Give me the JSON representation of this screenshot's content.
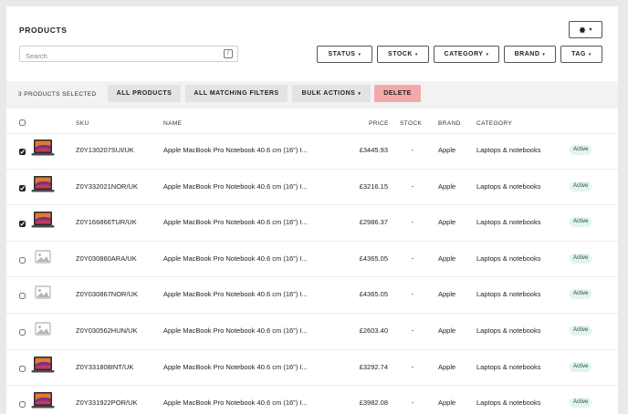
{
  "header": {
    "title": "PRODUCTS",
    "settings_icon": "gear-icon"
  },
  "search": {
    "placeholder": "Search",
    "shortcut": "/"
  },
  "filters": [
    {
      "label": "STATUS"
    },
    {
      "label": "STOCK"
    },
    {
      "label": "CATEGORY"
    },
    {
      "label": "BRAND"
    },
    {
      "label": "TAG"
    }
  ],
  "bulk": {
    "selected_text": "3 PRODUCTS SELECTED",
    "all_products": "ALL PRODUCTS",
    "all_matching": "ALL MATCHING FILTERS",
    "bulk_actions": "BULK ACTIONS",
    "delete": "DELETE"
  },
  "table": {
    "columns": {
      "sku": "SKU",
      "name": "NAME",
      "price": "PRICE",
      "stock": "STOCK",
      "brand": "BRAND",
      "category": "CATEGORY"
    },
    "rows": [
      {
        "selected": true,
        "image": "laptop",
        "sku": "Z0Y130207SUI/UK",
        "name": "Apple MacBook Pro Notebook 40.6 cm (16\") I...",
        "price": "£3445.93",
        "stock": "-",
        "brand": "Apple",
        "category": "Laptops & notebooks",
        "status": "Active"
      },
      {
        "selected": true,
        "image": "laptop",
        "sku": "Z0Y332021NOR/UK",
        "name": "Apple MacBook Pro Notebook 40.6 cm (16\") I...",
        "price": "£3216.15",
        "stock": "-",
        "brand": "Apple",
        "category": "Laptops & notebooks",
        "status": "Active"
      },
      {
        "selected": true,
        "image": "laptop",
        "sku": "Z0Y166866TUR/UK",
        "name": "Apple MacBook Pro Notebook 40.6 cm (16\") I...",
        "price": "£2986.37",
        "stock": "-",
        "brand": "Apple",
        "category": "Laptops & notebooks",
        "status": "Active"
      },
      {
        "selected": false,
        "image": "placeholder",
        "sku": "Z0Y030860ARA/UK",
        "name": "Apple MacBook Pro Notebook 40.6 cm (16\") I...",
        "price": "£4365.05",
        "stock": "-",
        "brand": "Apple",
        "category": "Laptops & notebooks",
        "status": "Active"
      },
      {
        "selected": false,
        "image": "placeholder",
        "sku": "Z0Y030867NOR/UK",
        "name": "Apple MacBook Pro Notebook 40.6 cm (16\") I...",
        "price": "£4365.05",
        "stock": "-",
        "brand": "Apple",
        "category": "Laptops & notebooks",
        "status": "Active"
      },
      {
        "selected": false,
        "image": "placeholder",
        "sku": "Z0Y030562HUN/UK",
        "name": "Apple MacBook Pro Notebook 40.6 cm (16\") I...",
        "price": "£2603.40",
        "stock": "-",
        "brand": "Apple",
        "category": "Laptops & notebooks",
        "status": "Active"
      },
      {
        "selected": false,
        "image": "laptop",
        "sku": "Z0Y331808INT/UK",
        "name": "Apple MacBook Pro Notebook 40.6 cm (16\") I...",
        "price": "£3292.74",
        "stock": "-",
        "brand": "Apple",
        "category": "Laptops & notebooks",
        "status": "Active"
      },
      {
        "selected": false,
        "image": "laptop",
        "sku": "Z0Y331922POR/UK",
        "name": "Apple MacBook Pro Notebook 40.6 cm (16\") I...",
        "price": "£3982.08",
        "stock": "-",
        "brand": "Apple",
        "category": "Laptops & notebooks",
        "status": "Active"
      }
    ]
  },
  "colors": {
    "delete_bg": "#f4a9a9",
    "badge_bg": "#e3f3ee",
    "bulk_bar_bg": "#f2f2f2"
  }
}
